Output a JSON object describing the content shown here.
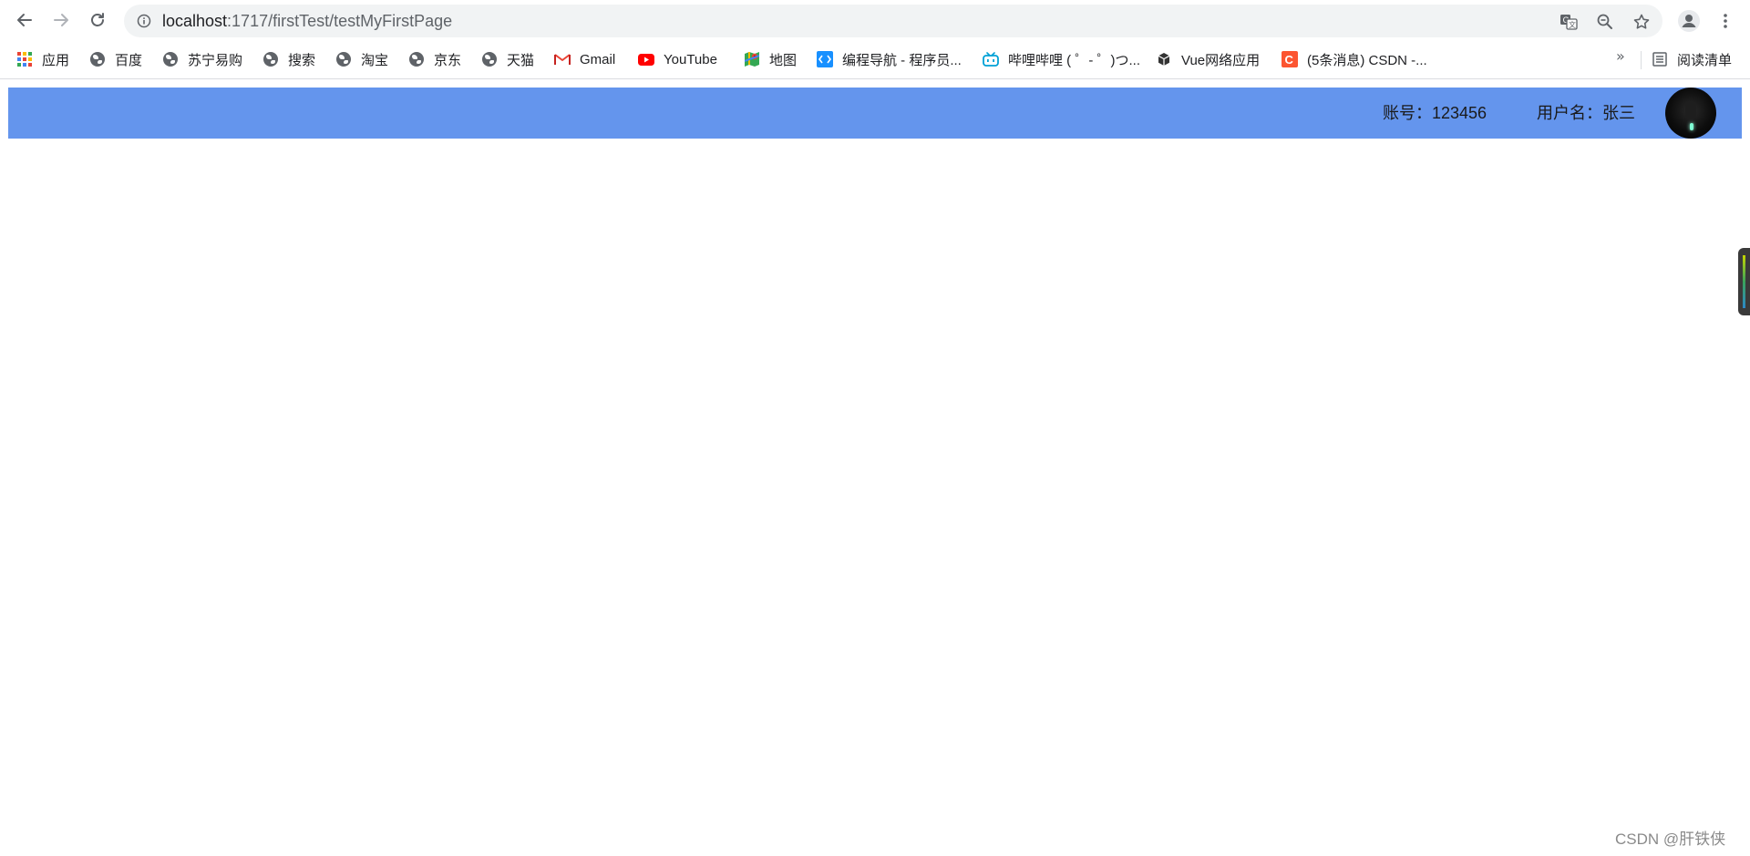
{
  "browser": {
    "url_host": "localhost",
    "url_path": ":1717/firstTest/testMyFirstPage"
  },
  "bookmarks": [
    {
      "label": "应用",
      "icon": "apps-grid-icon"
    },
    {
      "label": "百度",
      "icon": "globe-icon"
    },
    {
      "label": "苏宁易购",
      "icon": "globe-icon"
    },
    {
      "label": "搜索",
      "icon": "globe-icon"
    },
    {
      "label": "淘宝",
      "icon": "globe-icon"
    },
    {
      "label": "京东",
      "icon": "globe-icon"
    },
    {
      "label": "天猫",
      "icon": "globe-icon"
    },
    {
      "label": "Gmail",
      "icon": "gmail-icon"
    },
    {
      "label": "YouTube",
      "icon": "youtube-icon"
    },
    {
      "label": "地图",
      "icon": "maps-icon"
    },
    {
      "label": "编程导航 - 程序员...",
      "icon": "code-nav-icon"
    },
    {
      "label": "哔哩哔哩 ( ゜- ゜)つ...",
      "icon": "bilibili-icon"
    },
    {
      "label": "Vue网络应用",
      "icon": "cube-icon"
    },
    {
      "label": "(5条消息) CSDN -...",
      "icon": "csdn-icon"
    }
  ],
  "bookmarks_more": "»",
  "reading_list": "阅读清单",
  "header": {
    "account": "账号：123456",
    "username": "用户名：张三",
    "background_color": "#6495ed"
  },
  "watermark": "CSDN @肝铁侠"
}
